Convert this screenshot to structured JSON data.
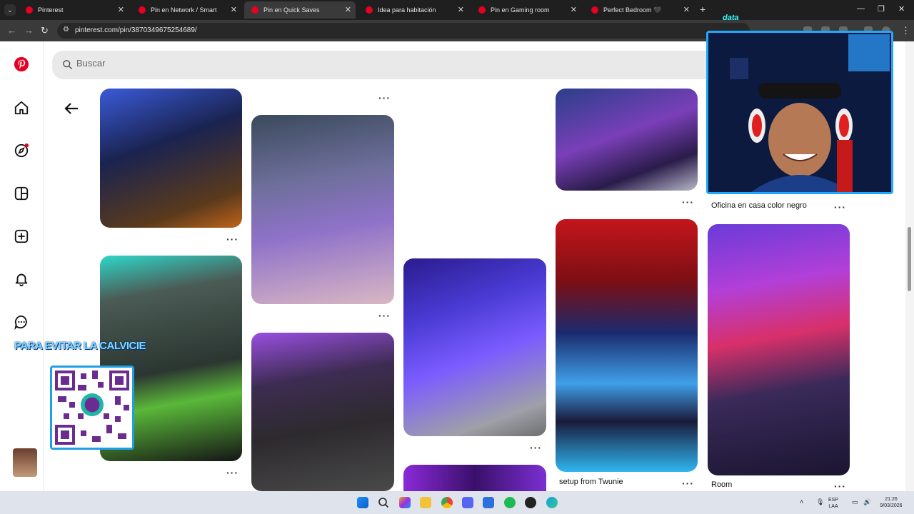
{
  "browser": {
    "tabs": [
      {
        "label": "Pinterest",
        "active": false
      },
      {
        "label": "Pin en Network / Smart",
        "active": false
      },
      {
        "label": "Pin en Quick Saves",
        "active": true
      },
      {
        "label": "Idea para habitación",
        "active": false
      },
      {
        "label": "Pin en Gaming room",
        "active": false
      },
      {
        "label": "Perfect Bedroom 🖤",
        "active": false
      }
    ],
    "url": "pinterest.com/pin/3870349675254689/"
  },
  "search": {
    "placeholder": "Buscar"
  },
  "pins": {
    "right_column_top_title": "Oficina en casa color negro",
    "setup_title": "setup from Twunie",
    "room_title": "Room"
  },
  "overlay": {
    "caption": "PARA EVITAR LA CALVICIE",
    "cam_logo": "data"
  },
  "taskbar": {
    "lang_1": "ESP",
    "lang_2": "LAA",
    "time": "21:26",
    "date": "9/03/2026"
  },
  "colors": {
    "pinterest_red": "#e60023",
    "cam_border": "#1fa8ff"
  }
}
